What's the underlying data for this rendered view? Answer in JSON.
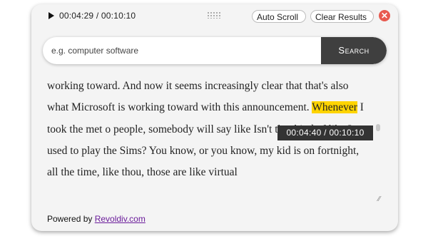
{
  "player": {
    "play_icon": "play-icon",
    "time": "00:04:29 / 00:10:10"
  },
  "toolbar": {
    "drag_icon": "drag-handle-icon",
    "auto_scroll_label": "Auto Scroll",
    "clear_results_label": "Clear Results",
    "close_icon": "close-icon",
    "close_symbol": "✕",
    "close_color": "#e85a4f"
  },
  "search": {
    "placeholder": "e.g. computer software",
    "value": "",
    "button_label": "Search"
  },
  "transcript": {
    "before": "working toward. And now it seems increasingly clear that that's also what Microsoft is working toward with this announcement. ",
    "highlight": "Whenever",
    "after": " I took the met o",
    "after2": " people, somebody will say like Isn't that kind of like I used to play the Sims? You know, or you know, my kid is on fortnight, all the time, like thou, those are like virtual",
    "highlight_color": "#ffd400"
  },
  "tooltip": {
    "time": "00:04:40 / 00:10:10"
  },
  "footer": {
    "prefix": "Powered by ",
    "link_text": "Revoldiv.com"
  }
}
